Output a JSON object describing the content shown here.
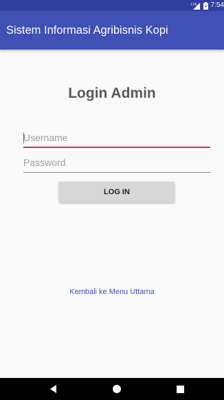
{
  "status_bar": {
    "network_label": "LTE",
    "time": "7:54"
  },
  "app_bar": {
    "title": "Sistem Informasi Agribisnis Kopi"
  },
  "login": {
    "heading": "Login Admin",
    "username_placeholder": "Username",
    "username_value": "",
    "password_placeholder": "Password",
    "password_value": "",
    "button_label": "LOG IN",
    "back_link": "Kembali ke Menu Uttama"
  },
  "colors": {
    "status_bar": "#303f9f",
    "app_bar": "#3f51b5",
    "accent": "#e91e63",
    "link": "#3f51b5"
  },
  "nav_bar": {
    "icons": [
      "back-icon",
      "home-icon",
      "recents-icon"
    ]
  }
}
